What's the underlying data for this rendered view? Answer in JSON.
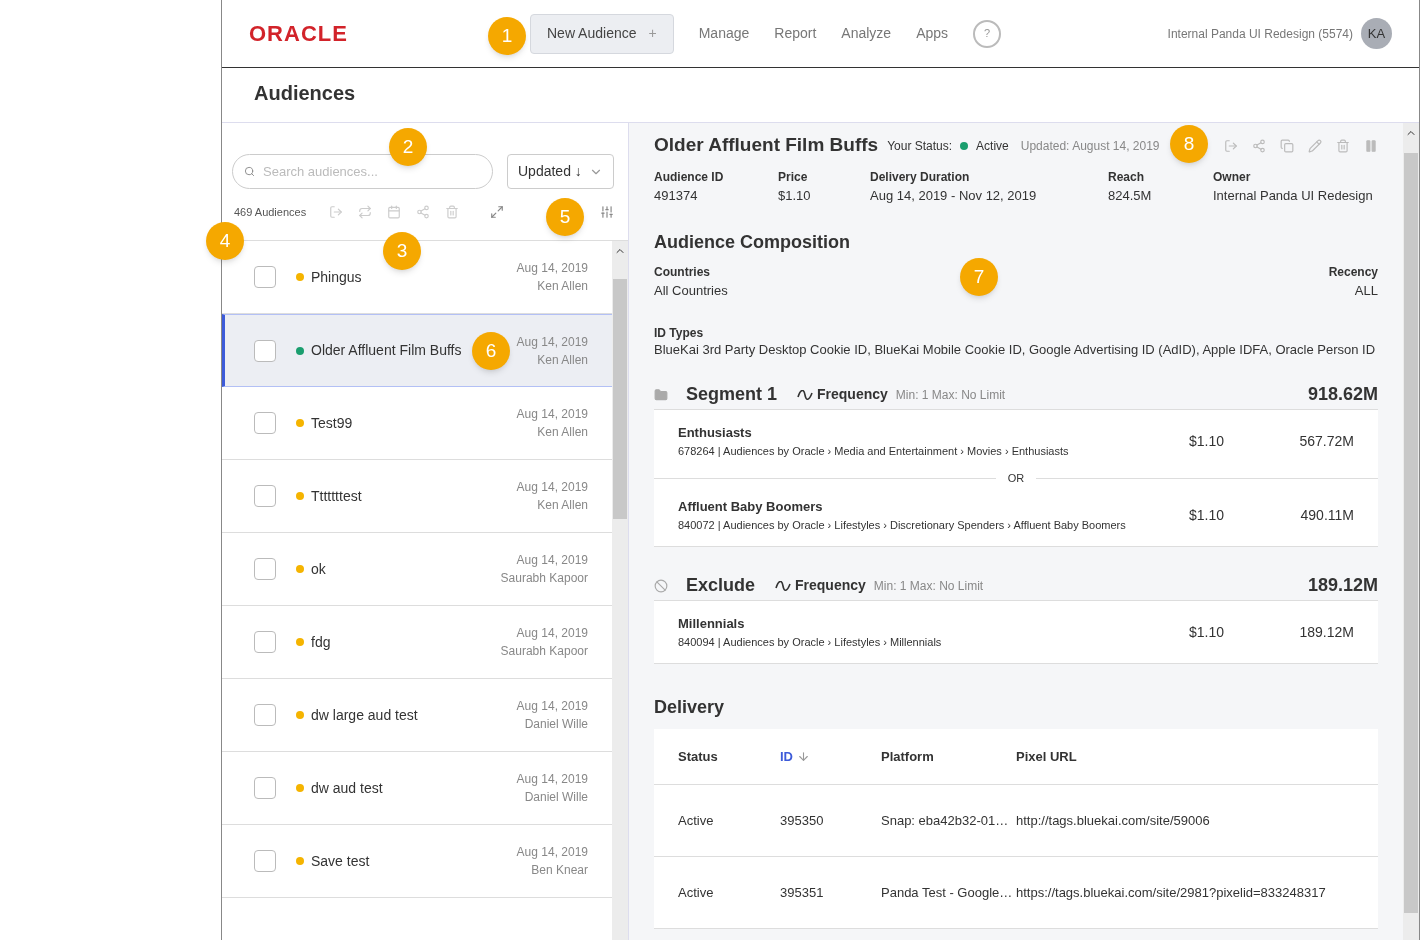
{
  "header": {
    "logo": "ORACLE",
    "new_button": {
      "label": "New Audience",
      "icon": "+"
    },
    "nav": [
      {
        "label": "Manage"
      },
      {
        "label": "Report"
      },
      {
        "label": "Analyze"
      },
      {
        "label": "Apps"
      }
    ],
    "help": "?",
    "account": "Internal Panda UI Redesign (5574)",
    "avatar": "KA"
  },
  "page_title": "Audiences",
  "list_panel": {
    "search": {
      "placeholder": "Search audiences..."
    },
    "sort": "Updated ↓",
    "count": "469 Audiences",
    "rows": [
      {
        "name": "Phingus",
        "date": "Aug 14, 2019",
        "owner": "Ken Allen",
        "color": "#f5b400",
        "selected": false,
        "checked": false
      },
      {
        "name": "Older Affluent Film Buffs",
        "date": "Aug 14, 2019",
        "owner": "Ken Allen",
        "color": "#1a9e6e",
        "selected": true,
        "checked": false
      },
      {
        "name": "Test99",
        "date": "Aug 14, 2019",
        "owner": "Ken Allen",
        "color": "#f5b400",
        "selected": false,
        "checked": false
      },
      {
        "name": "Tttttttest",
        "date": "Aug 14, 2019",
        "owner": "Ken Allen",
        "color": "#f5b400",
        "selected": false,
        "checked": false
      },
      {
        "name": "ok",
        "date": "Aug 14, 2019",
        "owner": "Saurabh Kapoor",
        "color": "#f5b400",
        "selected": false,
        "checked": false
      },
      {
        "name": "fdg",
        "date": "Aug 14, 2019",
        "owner": "Saurabh Kapoor",
        "color": "#f5b400",
        "selected": false,
        "checked": false
      },
      {
        "name": "dw large aud test",
        "date": "Aug 14, 2019",
        "owner": "Daniel Wille",
        "color": "#f5b400",
        "selected": false,
        "checked": false
      },
      {
        "name": "dw aud test",
        "date": "Aug 14, 2019",
        "owner": "Daniel Wille",
        "color": "#f5b400",
        "selected": false,
        "checked": false
      },
      {
        "name": "Save test",
        "date": "Aug 14, 2019",
        "owner": "Ben Knear",
        "color": "#f5b400",
        "selected": false,
        "checked": false
      }
    ]
  },
  "detail": {
    "title": "Older Affluent Film Buffs",
    "status_label": "Your Status:",
    "status": "Active",
    "updated": "Updated: August 14, 2019",
    "stats": [
      {
        "label": "Audience ID",
        "value": "491374"
      },
      {
        "label": "Price",
        "value": "$1.10"
      },
      {
        "label": "Delivery Duration",
        "value": "Aug 14, 2019 - Nov 12, 2019"
      },
      {
        "label": "Reach",
        "value": "824.5M"
      },
      {
        "label": "Owner",
        "value": "Internal Panda UI Redesign"
      }
    ],
    "composition": {
      "title": "Audience Composition",
      "countries_label": "Countries",
      "countries": "All Countries",
      "recency_label": "Recency",
      "recency": "ALL",
      "id_types_label": "ID Types",
      "id_types": "BlueKai 3rd Party Desktop Cookie ID, BlueKai Mobile Cookie ID, Google Advertising ID (AdID), Apple IDFA, Oracle Person ID"
    },
    "segments": [
      {
        "kind": "include",
        "title": "Segment 1",
        "frequency": "Frequency",
        "limits": "Min: 1 Max: No Limit",
        "total": "918.62M",
        "separator": "OR",
        "items": [
          {
            "name": "Enthusiasts",
            "path": "678264 | Audiences by Oracle › Media and Entertainment › Movies › Enthusiasts",
            "price": "$1.10",
            "reach": "567.72M"
          },
          {
            "name": "Affluent Baby Boomers",
            "path": "840072 | Audiences by Oracle › Lifestyles › Discretionary Spenders › Affluent Baby Boomers",
            "price": "$1.10",
            "reach": "490.11M"
          }
        ]
      },
      {
        "kind": "exclude",
        "title": "Exclude",
        "frequency": "Frequency",
        "limits": "Min: 1 Max: No Limit",
        "total": "189.12M",
        "items": [
          {
            "name": "Millennials",
            "path": "840094 | Audiences by Oracle › Lifestyles › Millennials",
            "price": "$1.10",
            "reach": "189.12M"
          }
        ]
      }
    ],
    "delivery": {
      "title": "Delivery",
      "columns": [
        {
          "label": "Status",
          "sorted": false
        },
        {
          "label": "ID",
          "sorted": true
        },
        {
          "label": "Platform",
          "sorted": false
        },
        {
          "label": "Pixel URL",
          "sorted": false
        }
      ],
      "rows": [
        [
          "Active",
          "395350",
          "Snap: eba42b32-01…",
          "http://tags.bluekai.com/site/59006"
        ],
        [
          "Active",
          "395351",
          "Panda Test - Google…",
          "https://tags.bluekai.com/site/2981?pixelid=833248317"
        ]
      ]
    }
  },
  "callouts": [
    {
      "label": "1"
    },
    {
      "label": "2"
    },
    {
      "label": "3"
    },
    {
      "label": "4"
    },
    {
      "label": "5"
    },
    {
      "label": "6"
    },
    {
      "label": "7"
    },
    {
      "label": "8"
    }
  ]
}
